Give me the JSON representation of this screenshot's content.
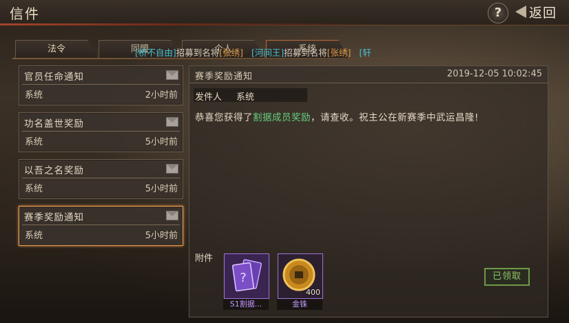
{
  "window": {
    "title": "信件"
  },
  "topbar": {
    "help_label": "?",
    "back_label": "返回"
  },
  "tabs": [
    {
      "label": "法令",
      "active": true
    },
    {
      "label": "同盟",
      "active": false
    },
    {
      "label": "个人",
      "active": false
    },
    {
      "label": "系统",
      "active": false
    }
  ],
  "marquee": [
    {
      "text": "[桥不自由]",
      "color": "cyan"
    },
    {
      "text": "招募到名将",
      "color": "white"
    },
    {
      "text": "[张绣]",
      "color": "orange"
    },
    {
      "text": "   ",
      "color": "white"
    },
    {
      "text": "[河间王]",
      "color": "cyan"
    },
    {
      "text": "招募到名将",
      "color": "white"
    },
    {
      "text": "[张绣]",
      "color": "orange"
    },
    {
      "text": "   ",
      "color": "white"
    },
    {
      "text": "[轩",
      "color": "cyan"
    }
  ],
  "mail_list": [
    {
      "title": "官员任命通知",
      "sender": "系统",
      "time": "2小时前",
      "selected": false
    },
    {
      "title": "功名盖世奖励",
      "sender": "系统",
      "time": "5小时前",
      "selected": false
    },
    {
      "title": "以吾之名奖励",
      "sender": "系统",
      "time": "5小时前",
      "selected": false
    },
    {
      "title": "赛季奖励通知",
      "sender": "系统",
      "time": "5小时前",
      "selected": true
    }
  ],
  "detail": {
    "title": "赛季奖励通知",
    "date": "2019-12-05 10:02:45",
    "sender_label": "发件人",
    "sender": "系统",
    "body_before": "恭喜您获得了",
    "body_highlight": "割据成员奖励",
    "body_after": "，请查收。祝主公在新赛季中武运昌隆!",
    "attachments_label": "附件",
    "attachments": [
      {
        "name": "S1割据...",
        "quantity": "",
        "icon": "purple-card-pack-icon"
      },
      {
        "name": "金铢",
        "quantity": "400",
        "icon": "gold-coin-icon"
      }
    ],
    "claimed_label": "已领取"
  },
  "colors": {
    "accent_orange": "#e8a05a",
    "highlight_green": "#66d07e",
    "item_purple": "#c497ff",
    "marquee_cyan": "#47c1d6"
  }
}
